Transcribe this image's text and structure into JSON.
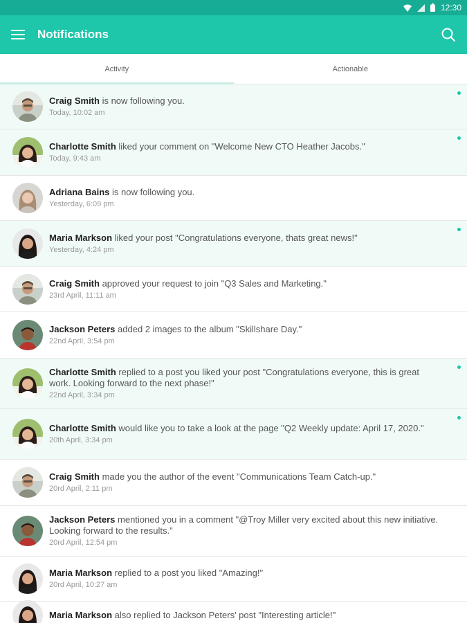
{
  "status": {
    "time": "12:30"
  },
  "app_bar": {
    "title": "Notifications"
  },
  "tabs": [
    {
      "label": "Activity",
      "active": true
    },
    {
      "label": "Actionable",
      "active": false
    }
  ],
  "notifications": [
    {
      "name": "Craig Smith",
      "text": " is now following you.",
      "time": "Today, 10:02 am",
      "unread": true,
      "avatar": "craig"
    },
    {
      "name": "Charlotte Smith",
      "text": " liked your comment on \"Welcome New CTO Heather Jacobs.\"",
      "time": "Today, 9:43 am",
      "unread": true,
      "avatar": "charlotte"
    },
    {
      "name": "Adriana Bains",
      "text": " is now following you.",
      "time": "Yesterday, 6:09 pm",
      "unread": false,
      "avatar": "adriana"
    },
    {
      "name": "Maria Markson",
      "text": " liked your post \"Congratulations everyone, thats great news!\"",
      "time": "Yesterday, 4:24 pm",
      "unread": true,
      "avatar": "maria"
    },
    {
      "name": "Craig Smith",
      "text": " approved your request to join \"Q3 Sales and Marketing.\"",
      "time": "23rd April, 11:11 am",
      "unread": false,
      "avatar": "craig"
    },
    {
      "name": "Jackson Peters",
      "text": " added 2 images to the album \"Skillshare Day.\"",
      "time": "22nd April, 3:54 pm",
      "unread": false,
      "avatar": "jackson"
    },
    {
      "name": "Charlotte Smith",
      "text": " replied to a post you liked your post \"Congratulations everyone, this is great work. Looking forward to the next phase!\"",
      "time": "22nd April, 3:34 pm",
      "unread": true,
      "avatar": "charlotte"
    },
    {
      "name": "Charlotte Smith",
      "text": " would like you to take a look at the page \"Q2 Weekly update: April 17, 2020.\"",
      "time": "20th April, 3:34 pm",
      "unread": true,
      "avatar": "charlotte"
    },
    {
      "name": "Craig Smith",
      "text": " made you the author of the event \"Communications Team Catch-up.\"",
      "time": "20rd April, 2:11 pm",
      "unread": false,
      "avatar": "craig"
    },
    {
      "name": "Jackson Peters",
      "text": " mentioned you in a comment \"@Troy Miller very excited about this new initiative. Looking forward to the results.\"",
      "time": "20rd April, 12:54 pm",
      "unread": false,
      "avatar": "jackson"
    },
    {
      "name": "Maria Markson",
      "text": " replied to a post you liked \"Amazing!\"",
      "time": "20rd April, 10:27 am",
      "unread": false,
      "avatar": "maria"
    },
    {
      "name": "Maria Markson",
      "text": " also replied to Jackson Peters' post \"Interesting article!\"",
      "time": "",
      "unread": false,
      "avatar": "maria"
    }
  ],
  "colors": {
    "primary": "#1ec6aa",
    "status_bar": "#16ad94",
    "unread_bg": "#f0fbf8"
  }
}
